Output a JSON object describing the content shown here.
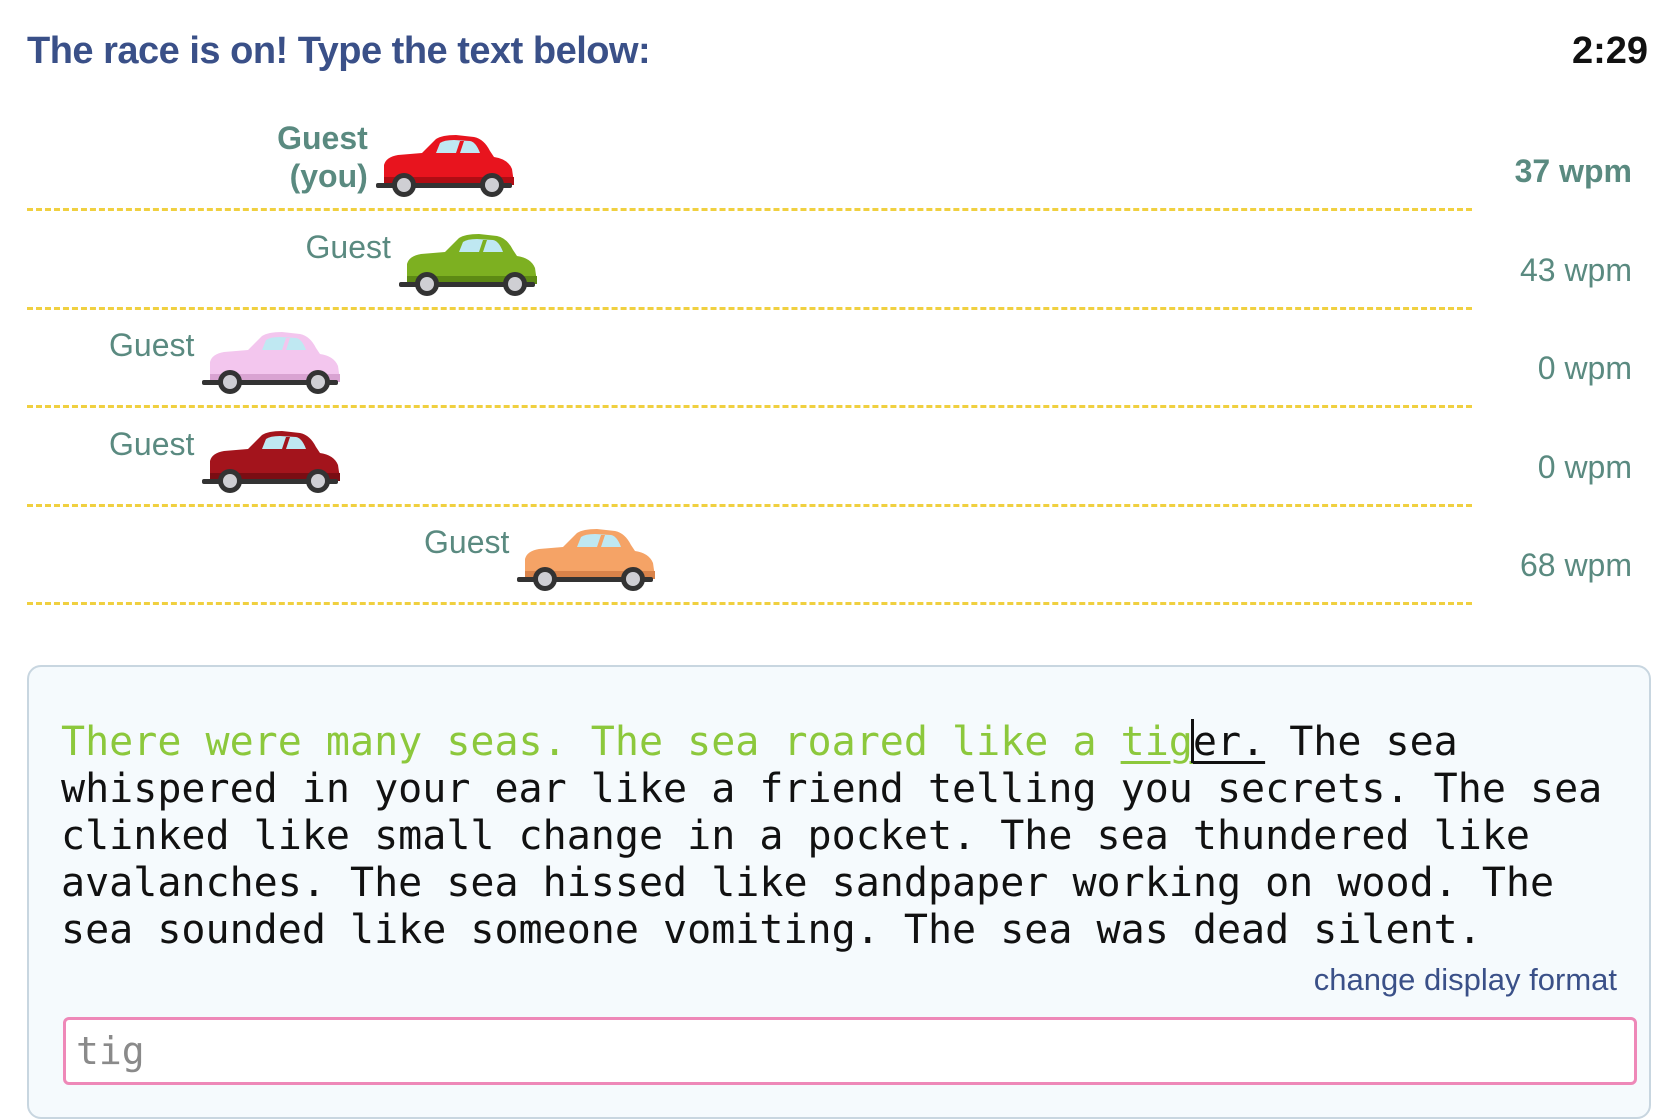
{
  "header": {
    "status": "The race is on! Type the text below:",
    "timer": "2:29"
  },
  "racers": [
    {
      "name": "Guest\n(you)",
      "wpm": "37 wpm",
      "is_you": true,
      "progress": 0.24,
      "car_color": "#e8141e",
      "car_shade": "#b00d14"
    },
    {
      "name": "Guest",
      "wpm": "43 wpm",
      "is_you": false,
      "progress": 0.256,
      "car_color": "#7db021",
      "car_shade": "#5d8a14"
    },
    {
      "name": "Guest",
      "wpm": "0 wpm",
      "is_you": false,
      "progress": 0.12,
      "car_color": "#f3c6ee",
      "car_shade": "#d9a3d2"
    },
    {
      "name": "Guest",
      "wpm": "0 wpm",
      "is_you": false,
      "progress": 0.12,
      "car_color": "#a3141c",
      "car_shade": "#7a0d13"
    },
    {
      "name": "Guest",
      "wpm": "68 wpm",
      "is_you": false,
      "progress": 0.338,
      "car_color": "#f5a366",
      "car_shade": "#d9834a"
    }
  ],
  "text": {
    "typed": "There were many seas. The sea roared like a ",
    "current_typed": "tig",
    "current_rest": "er.",
    "remaining": " The sea whispered in your ear like a friend telling you secrets. The sea clinked like small change in a pocket. The sea thundered like avalanches. The sea hissed like sandpaper working on wood. The sea sounded like someone vomiting. The sea was dead silent."
  },
  "links": {
    "change_display_format": "change display format"
  },
  "input": {
    "value": "tig"
  },
  "colors": {
    "title": "#3a5088",
    "typed_text": "#8cc83c",
    "lane_divider": "#f0d040",
    "racer_label": "#5a8a80",
    "input_border": "#ee88b8"
  }
}
